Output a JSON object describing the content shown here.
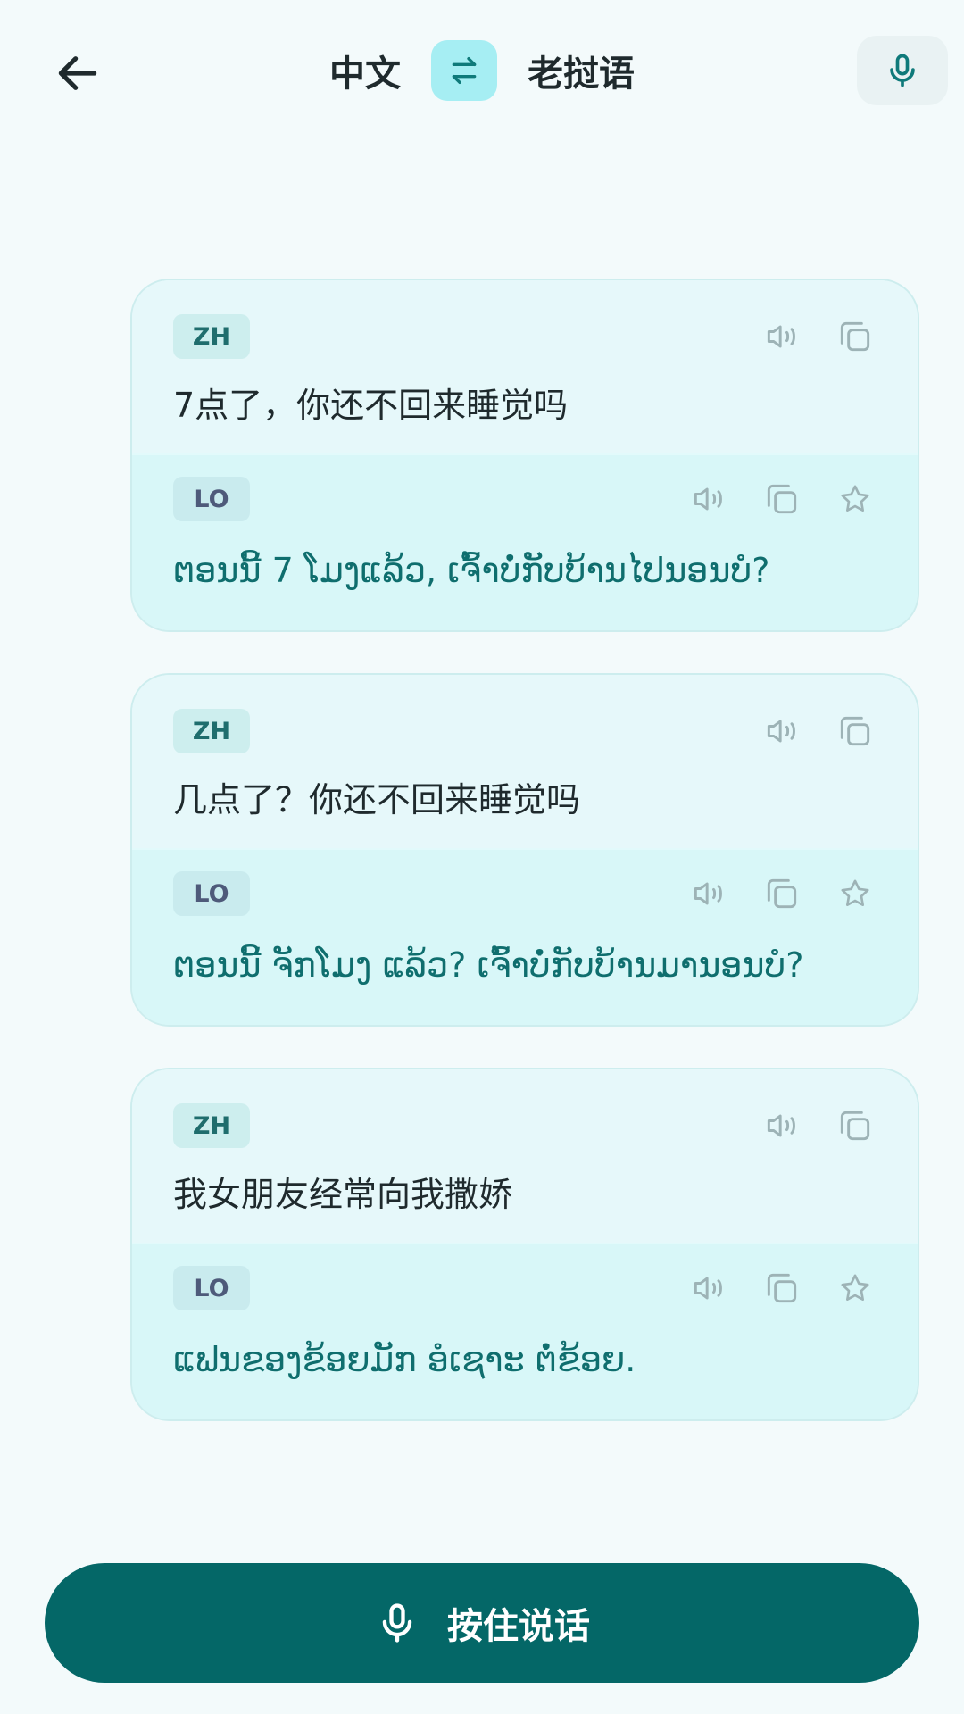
{
  "header": {
    "source_language": "中文",
    "target_language": "老挝语",
    "icons": {
      "back": "arrow-left-icon",
      "swap": "swap-arrows-icon",
      "mic": "microphone-icon"
    }
  },
  "messages": [
    {
      "source_badge": "ZH",
      "source_text": "7点了，你还不回来睡觉吗",
      "target_badge": "LO",
      "target_text": "ຕອນນີ້ 7 ໂມງແລ້ວ, ເຈົ້າບໍ່ກັບບ້ານໄປນອນບໍ?"
    },
    {
      "source_badge": "ZH",
      "source_text": "几点了？你还不回来睡觉吗",
      "target_badge": "LO",
      "target_text": "ຕອນນີ້ ຈັກໂມງ ແລ້ວ? ເຈົ້າບໍ່ກັບບ້ານມານອນບໍ?"
    },
    {
      "source_badge": "ZH",
      "source_text": "我女朋友经常向我撒娇",
      "target_badge": "LO",
      "target_text": "ແຟນຂອງຂ້ອຍມັກ ອໍເຊາະ ຕໍ່ຂ້ອຍ."
    }
  ],
  "card_icons": {
    "speak": "speaker-icon",
    "copy": "copy-icon",
    "favorite": "star-icon"
  },
  "bottom": {
    "hold_to_speak": "按住说话",
    "icon": "microphone-icon"
  },
  "colors": {
    "primary": "#046767",
    "swap_bg": "#A6EEF3",
    "page_bg": "#F3FAFB",
    "card_bg": "#E6F8FA",
    "translation_bg": "#D8F7F8",
    "translation_text": "#0F6E6E"
  }
}
